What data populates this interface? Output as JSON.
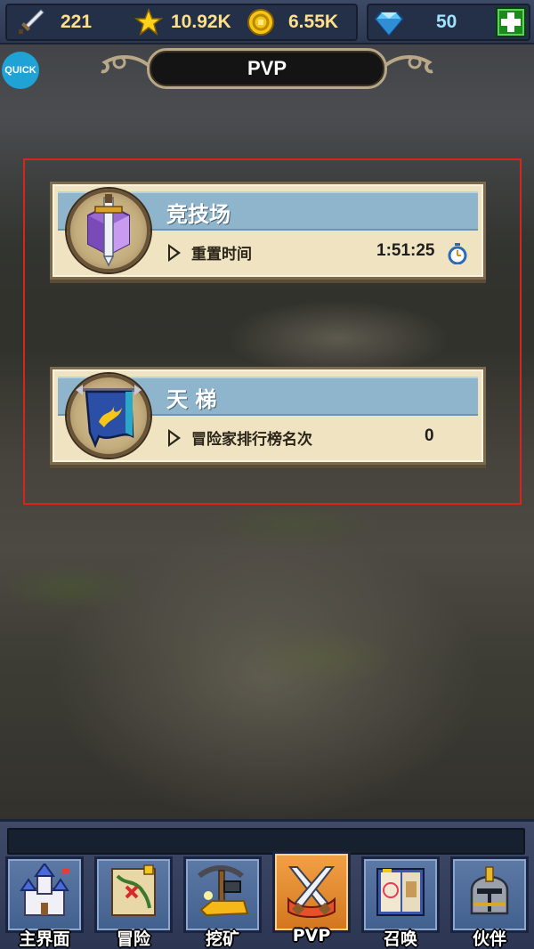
{
  "resources": {
    "attack": "221",
    "stars": "10.92K",
    "gold": "6.55K",
    "gems": "50"
  },
  "icons": {
    "attack": "sword-icon",
    "stars": "star-icon",
    "gold": "coin-icon",
    "gems": "diamond-icon",
    "add": "plus-icon"
  },
  "quick_button": "QUICK",
  "title": "PVP",
  "modes": [
    {
      "name": "竞技场",
      "sub_label": "重置时间",
      "value": "1:51:25",
      "icon": "sword-crystal-icon"
    },
    {
      "name": "天 梯",
      "sub_label": "冒险家排行榜名次",
      "value": "0",
      "icon": "banner-flag-icon"
    }
  ],
  "nav": [
    {
      "label": "主界面",
      "icon": "castle-icon",
      "active": false
    },
    {
      "label": "冒险",
      "icon": "map-icon",
      "active": false
    },
    {
      "label": "挖矿",
      "icon": "pickaxe-icon",
      "active": false
    },
    {
      "label": "PVP",
      "icon": "crossed-swords-icon",
      "active": true
    },
    {
      "label": "召唤",
      "icon": "spellbook-icon",
      "active": false
    },
    {
      "label": "伙伴",
      "icon": "helmet-icon",
      "active": false
    }
  ],
  "colors": {
    "accent_active_tab": "#e58a2e",
    "selection_frame": "#d8241c",
    "card_band": "#8fb5cc",
    "gem_value": "#9fe3ff",
    "resource_value": "#ffe08a"
  }
}
